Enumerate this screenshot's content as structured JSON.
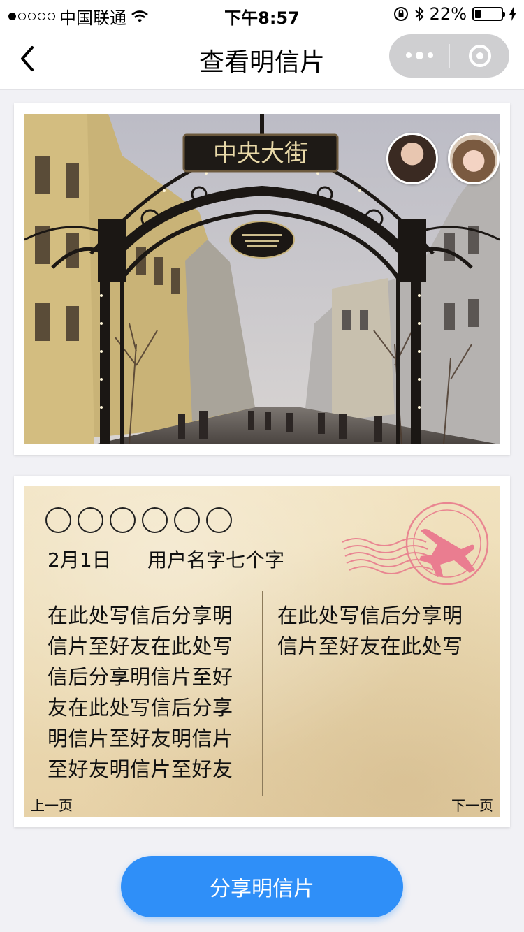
{
  "status_bar": {
    "carrier": "中国联通",
    "time": "下午8:57",
    "battery": "22%",
    "battery_level": 0.22
  },
  "nav": {
    "title": "查看明信片"
  },
  "photo": {
    "sign_text": "中央大街"
  },
  "letter": {
    "date": "2月1日",
    "username": "用户名字七个字",
    "left_text": "在此处写信后分享明信片至好友在此处写信后分享明信片至好友在此处写信后分享明信片至好友明信片至好友明信片至好友",
    "right_text": "在此处写信后分享明信片至好友在此处写",
    "prev_label": "上一页",
    "next_label": "下一页"
  },
  "share_button": {
    "label": "分享明信片"
  },
  "colors": {
    "accent": "#2f8ff8",
    "stamp": "#e8768a"
  }
}
